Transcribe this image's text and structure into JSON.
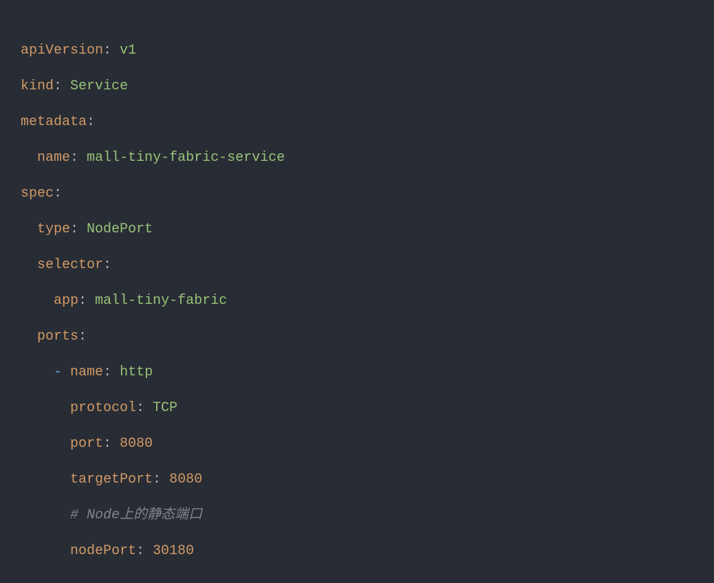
{
  "yaml": {
    "apiVersion": {
      "key": "apiVersion",
      "val": "v1"
    },
    "kind": {
      "key": "kind",
      "val": "Service"
    },
    "metadata": {
      "key": "metadata"
    },
    "metadataName": {
      "key": "name",
      "val": "mall-tiny-fabric-service"
    },
    "spec": {
      "key": "spec"
    },
    "specType": {
      "key": "type",
      "val": "NodePort"
    },
    "selector": {
      "key": "selector"
    },
    "selectorApp": {
      "key": "app",
      "val": "mall-tiny-fabric"
    },
    "ports": {
      "key": "ports"
    },
    "portDash": "-",
    "portName": {
      "key": "name",
      "val": "http"
    },
    "portProtocol": {
      "key": "protocol",
      "val": "TCP"
    },
    "portPort": {
      "key": "port",
      "val": "8080"
    },
    "targetPort": {
      "key": "targetPort",
      "val": "8080"
    },
    "comment": "# Node上的静态端口",
    "nodePort": {
      "key": "nodePort",
      "val": "30180"
    }
  }
}
